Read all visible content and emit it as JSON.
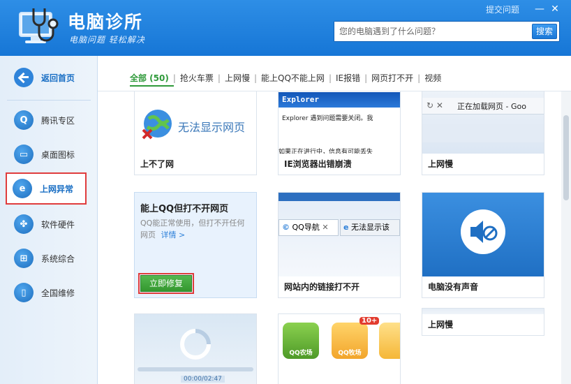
{
  "app": {
    "title": "电脑诊所",
    "subtitle": "电脑问题 轻松解决"
  },
  "topbar": {
    "submit_label": "提交问题",
    "minimize": "—",
    "close": "✕"
  },
  "search": {
    "placeholder": "您的电脑遇到了什么问题？",
    "button": "搜索"
  },
  "sidebar": {
    "back_label": "返回首页",
    "items": [
      {
        "label": "腾讯专区",
        "icon": "qq-penguin-icon",
        "glyph": "Q"
      },
      {
        "label": "桌面图标",
        "icon": "desktop-monitor-icon",
        "glyph": "▭"
      },
      {
        "label": "上网异常",
        "icon": "ie-browser-icon",
        "glyph": "e"
      },
      {
        "label": "软件硬件",
        "icon": "software-hardware-icon",
        "glyph": "✤"
      },
      {
        "label": "系统综合",
        "icon": "windows-logo-icon",
        "glyph": "⊞"
      },
      {
        "label": "全国维修",
        "icon": "phone-repair-icon",
        "glyph": "▯"
      }
    ]
  },
  "tabs": [
    {
      "label": "全部 (50)",
      "active": true
    },
    {
      "label": "抢火车票"
    },
    {
      "label": "上网慢"
    },
    {
      "label": "能上QQ不能上网"
    },
    {
      "label": "IE报错"
    },
    {
      "label": "网页打不开"
    },
    {
      "label": "视频"
    }
  ],
  "cards": {
    "c1": {
      "caption": "上不了网",
      "thumb_text": "无法显示网页"
    },
    "c2": {
      "caption": "IE浏览器出错崩溃",
      "thumb_title": "Explorer",
      "thumb_text": "Explorer 遇到问题需要关闭。我",
      "thumb_text2": "如果正在进行中，信息有可能丢失"
    },
    "c3": {
      "caption": "上网慢",
      "thumb_text": "正在加载网页 - Goo"
    },
    "c4": {
      "title": "能上QQ但打不开网页",
      "desc": "QQ能正常使用，但打不开任何网页",
      "detail": "详情 >",
      "fix_button": "立即修复"
    },
    "c5": {
      "caption": "网站内的链接打不开",
      "tab1": "QQ导航",
      "tab2": "无法显示该"
    },
    "c6": {
      "caption": "电脑没有声音"
    },
    "c7": {
      "caption": "",
      "time_text": "00:00/02:47"
    },
    "c8": {
      "caption": "",
      "badge": "10+",
      "game1": "QQ农场",
      "game2": "QQ牧场"
    },
    "c9": {
      "caption": "上网慢"
    }
  }
}
